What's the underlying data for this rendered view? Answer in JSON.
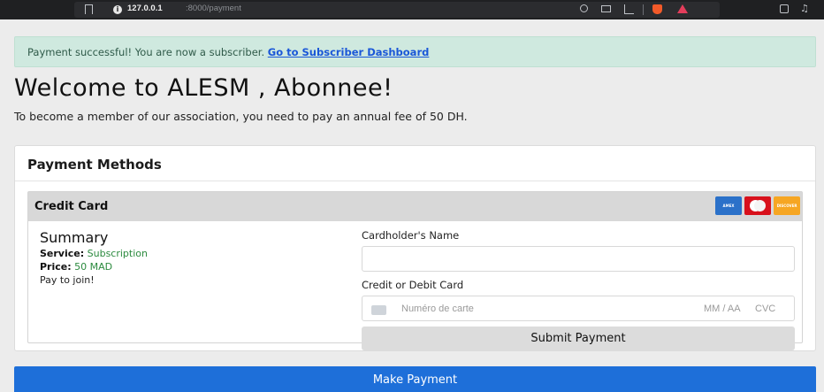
{
  "browser": {
    "url_host": "127.0.0.1",
    "url_path": ":8000/payment"
  },
  "alert": {
    "message": "Payment successful! You are now a subscriber.",
    "link_text": "Go to Subscriber Dashboard"
  },
  "welcome": {
    "title": "Welcome to ALESM , Abonnee!",
    "intro": "To become a member of our association, you need to pay an annual fee of 50 DH."
  },
  "payment_methods": {
    "heading": "Payment Methods",
    "credit_card": {
      "label": "Credit Card",
      "logos": [
        "amex-icon",
        "mastercard-icon",
        "discover-icon"
      ]
    },
    "summary": {
      "heading": "Summary",
      "service_label": "Service:",
      "service_value": "Subscription",
      "price_label": "Price:",
      "price_value": "50 MAD",
      "note": "Pay to join!"
    },
    "form": {
      "cardholder_label": "Cardholder's Name",
      "cardholder_value": "",
      "card_label": "Credit or Debit Card",
      "card_number_placeholder": "Numéro de carte",
      "expiry_placeholder": "MM / AA",
      "cvc_placeholder": "CVC",
      "submit_label": "Submit Payment"
    }
  },
  "make_payment_label": "Make Payment",
  "colors": {
    "alert_bg": "#cfe9df",
    "link": "#1a57d8",
    "success_value": "#2b8a3e",
    "primary_button": "#1e6fd9"
  }
}
